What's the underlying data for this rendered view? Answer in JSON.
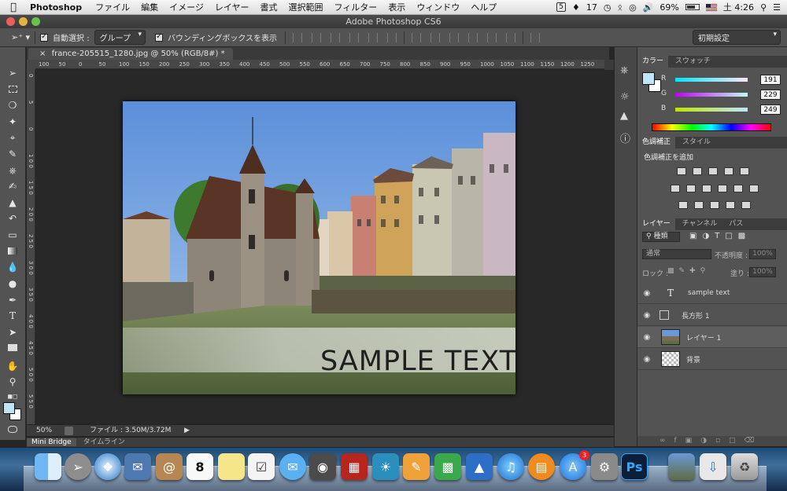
{
  "menubar": {
    "app_name": "Photoshop",
    "items": [
      "ファイル",
      "編集",
      "イメージ",
      "レイヤー",
      "書式",
      "選択範囲",
      "フィルター",
      "表示",
      "ウィンドウ",
      "ヘルプ"
    ],
    "status": {
      "adobe_badge": "17",
      "battery": "69%",
      "clock": "土 4:26"
    }
  },
  "window": {
    "title": "Adobe Photoshop CS6"
  },
  "options_bar": {
    "auto_select_label": "自動選択 :",
    "auto_select_value": "グループ",
    "bounding_box_label": "バウンディングボックスを表示",
    "workspace": "初期設定"
  },
  "document": {
    "tab_title": "france-205515_1280.jpg @ 50% (RGB/8#) *",
    "ruler_h_ticks": [
      "100",
      "50",
      "0",
      "50",
      "100",
      "150",
      "200",
      "250",
      "300",
      "350",
      "400",
      "450",
      "500",
      "550",
      "600",
      "650",
      "700",
      "750",
      "800",
      "850",
      "900",
      "950",
      "1000",
      "1050",
      "1100",
      "1150",
      "1200",
      "1250"
    ],
    "ruler_v_ticks": [
      "0",
      "5",
      "0",
      "1 0 0",
      "1 5 0",
      "2 0 0",
      "2 5 0",
      "3 0 0",
      "3 5 0",
      "4 0 0",
      "4 5 0",
      "5 0 0",
      "5 5 0"
    ],
    "sample_text": "SAMPLE TEXT"
  },
  "statusbar": {
    "zoom": "50%",
    "file_info": "ファイル : 3.50M/3.72M"
  },
  "bottom_tabs": [
    "Mini Bridge",
    "タイムライン"
  ],
  "color_panel": {
    "tabs": [
      "カラー",
      "スウォッチ"
    ],
    "channels": [
      {
        "label": "R",
        "value": "191"
      },
      {
        "label": "G",
        "value": "229"
      },
      {
        "label": "B",
        "value": "249"
      }
    ],
    "foreground": "#bfe5f9"
  },
  "adjustments_panel": {
    "tabs": [
      "色調補正",
      "スタイル"
    ],
    "heading": "色調補正を追加"
  },
  "layers_panel": {
    "tabs": [
      "レイヤー",
      "チャンネル",
      "パス"
    ],
    "filter_kind": "種類",
    "blend_mode": "通常",
    "opacity_label": "不透明度 :",
    "opacity_value": "100%",
    "lock_label": "ロック :",
    "fill_label": "塗り :",
    "fill_value": "100%",
    "layers": [
      {
        "name": "sample text",
        "type": "text"
      },
      {
        "name": "長方形 1",
        "type": "shape"
      },
      {
        "name": "レイヤー 1",
        "type": "image"
      },
      {
        "name": "背景",
        "type": "background"
      }
    ]
  },
  "dock": {
    "icons": [
      "finder-icon",
      "launchpad-icon",
      "safari-icon",
      "mail-icon",
      "contacts-icon",
      "calendar-icon",
      "notes-icon",
      "reminders-icon",
      "messages-icon",
      "facetime-icon",
      "photo-booth-icon",
      "iphoto-icon",
      "pages-icon",
      "numbers-icon",
      "keynote-icon",
      "itunes-icon",
      "ibooks-icon",
      "app-store-icon",
      "system-preferences-icon",
      "photoshop-icon",
      "photos-stack-icon",
      "downloads-icon",
      "trash-icon"
    ],
    "calendar_day": "8",
    "app_store_badge": "3",
    "ps_label": "Ps"
  }
}
